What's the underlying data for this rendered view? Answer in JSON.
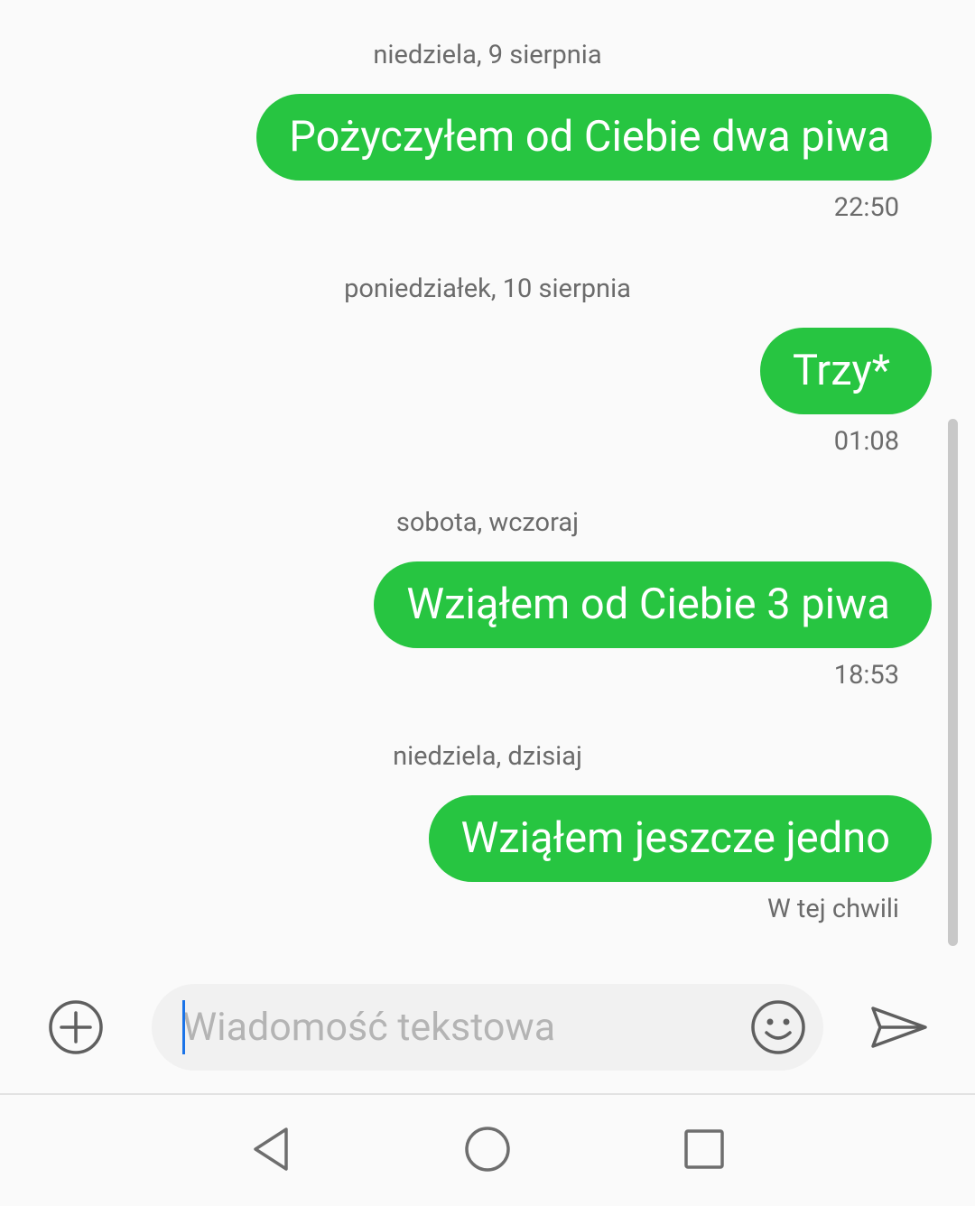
{
  "conversation": {
    "groups": [
      {
        "date": "niedziela, 9 sierpnia",
        "message": "Pożyczyłem od Ciebie dwa piwa",
        "time": "22:50"
      },
      {
        "date": "poniedziałek, 10 sierpnia",
        "message": "Trzy*",
        "time": "01:08"
      },
      {
        "date": "sobota, wczoraj",
        "message": "Wziąłem od Ciebie 3 piwa",
        "time": "18:53"
      },
      {
        "date": "niedziela, dzisiaj",
        "message": "Wziąłem jeszcze jedno",
        "time": "W tej chwili"
      }
    ]
  },
  "composer": {
    "placeholder": "Wiadomość tekstowa",
    "add_icon": "plus-circle-icon",
    "emoji_icon": "smiley-icon",
    "send_icon": "send-icon"
  },
  "navbar": {
    "back_icon": "back-triangle-icon",
    "home_icon": "home-circle-icon",
    "recents_icon": "recents-square-icon"
  },
  "colors": {
    "bubble": "#27c541",
    "bubble_text": "#ffffff",
    "meta_text": "#6b6b6b",
    "background": "#fafafa",
    "input_bg": "#f1f1f1",
    "caret": "#1a73e8"
  }
}
